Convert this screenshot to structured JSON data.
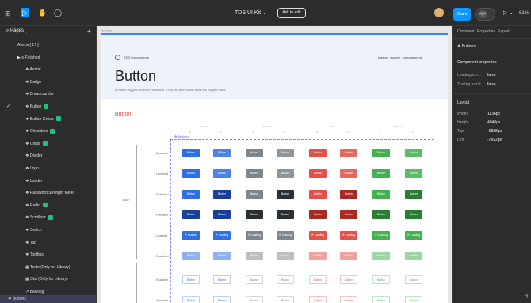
{
  "toolbar": {
    "title": "TDS UI Kit",
    "title_caret": "⌄",
    "ask_edit": "Ask to edit",
    "share": "Share",
    "code_icon": "</>",
    "play_icon": "▷ ⌄",
    "zoom": "61%"
  },
  "left": {
    "pages_label": "Pages",
    "items": [
      {
        "label": "Atoms [ 17 ]"
      },
      {
        "label": "▶ ≡ Finished"
      },
      {
        "label": "❖ Avatar"
      },
      {
        "label": "❖ Badge"
      },
      {
        "label": "❖ Breadcrumbs"
      },
      {
        "label": "❖ Button"
      },
      {
        "label": "❖ Button Group"
      },
      {
        "label": "❖ Checkbox"
      },
      {
        "label": "❖ Chips"
      },
      {
        "label": "❖ Divider"
      },
      {
        "label": "❖ Logo"
      },
      {
        "label": "❖ Loader"
      },
      {
        "label": "❖ Password Strength Meter"
      },
      {
        "label": "❖ Radio"
      },
      {
        "label": "❖ Scrollbar"
      },
      {
        "label": "❖ Switch"
      },
      {
        "label": "❖ Tag"
      },
      {
        "label": "❖ Tooltips"
      },
      {
        "label": "▦ Texts (Only for Library)"
      },
      {
        "label": "▦ Slot (Only for Library)"
      },
      {
        "label": "↗ Backlog"
      }
    ],
    "layer": "Buttons"
  },
  "right": {
    "tabs": "Comment Properties Export",
    "comp_name": "Buttons",
    "comp_props_title": "Component properties",
    "props": [
      {
        "k": "Leading ico...",
        "v": "false"
      },
      {
        "k": "Trailing icon?",
        "v": "false"
      }
    ],
    "layout_title": "Layout",
    "layout": [
      {
        "k": "Width",
        "v": "1136px"
      },
      {
        "k": "Height",
        "v": "4040px"
      },
      {
        "k": "Top",
        "v": "-6888px"
      },
      {
        "k": "Left",
        "v": "-7692px"
      }
    ]
  },
  "canvas": {
    "page_name": "Button",
    "comp_label": "TDS Components",
    "crumb": "tossbp · system · management",
    "title": "Button",
    "desc": "A button triggers an event or action. They let users know what will happen next.",
    "section_title": "Button",
    "group_heads": [
      "Primary",
      "Neutral",
      "Line",
      "Success"
    ],
    "sub_heads": [
      "p",
      "s",
      "p",
      "s",
      "p",
      "s",
      "p",
      "s"
    ],
    "set_label": "❖ Buttons",
    "group_label": "Blue",
    "row_labels": [
      "Enabled",
      "Hovered",
      "Selected",
      "Pressed",
      "Loading",
      "Disabled",
      "Enabled",
      "Hovered"
    ],
    "btn": "Button",
    "loading": "⟳ Loading"
  },
  "colors": {
    "blue": "#2f6fe4",
    "blue_dark": "#1a3f9a",
    "grey": "#7f858d",
    "dark": "#2b2f36",
    "red": "#e0524a",
    "red_dark": "#a82a23",
    "green": "#43b14e",
    "green_dark": "#2a7d33"
  }
}
